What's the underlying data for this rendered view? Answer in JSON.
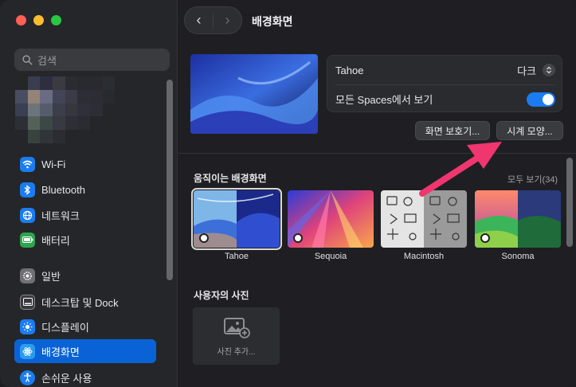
{
  "window": {
    "title": "배경화면"
  },
  "search": {
    "placeholder": "검색"
  },
  "sidebar": {
    "items": [
      {
        "label": "Wi-Fi",
        "icon": "wifi-icon"
      },
      {
        "label": "Bluetooth",
        "icon": "bluetooth-icon"
      },
      {
        "label": "네트워크",
        "icon": "globe-icon"
      },
      {
        "label": "배터리",
        "icon": "battery-icon"
      },
      {
        "label": "일반",
        "icon": "gear-icon"
      },
      {
        "label": "데스크탑 및 Dock",
        "icon": "dock-icon"
      },
      {
        "label": "디스플레이",
        "icon": "sun-icon"
      },
      {
        "label": "배경화면",
        "icon": "wallpaper-icon",
        "active": true
      },
      {
        "label": "손쉬운 사용",
        "icon": "accessibility-icon"
      }
    ]
  },
  "current": {
    "wallpaper_name": "Tahoe",
    "appearance_value": "다크",
    "show_all_spaces_label": "모든 Spaces에서 보기",
    "show_all_spaces_on": true
  },
  "buttons": {
    "screensaver": "화면 보호기...",
    "clock": "시계 모양..."
  },
  "sections": {
    "dynamic": {
      "title": "움직이는 배경화면",
      "see_all": "모두 보기(34)",
      "items": [
        "Tahoe",
        "Sequoia",
        "Macintosh",
        "Sonoma"
      ]
    },
    "photos": {
      "title": "사용자의 사진",
      "add_label": "사진 추가..."
    }
  },
  "colors": {
    "accent": "#0a63d6",
    "annotation_arrow": "#f0366f"
  }
}
